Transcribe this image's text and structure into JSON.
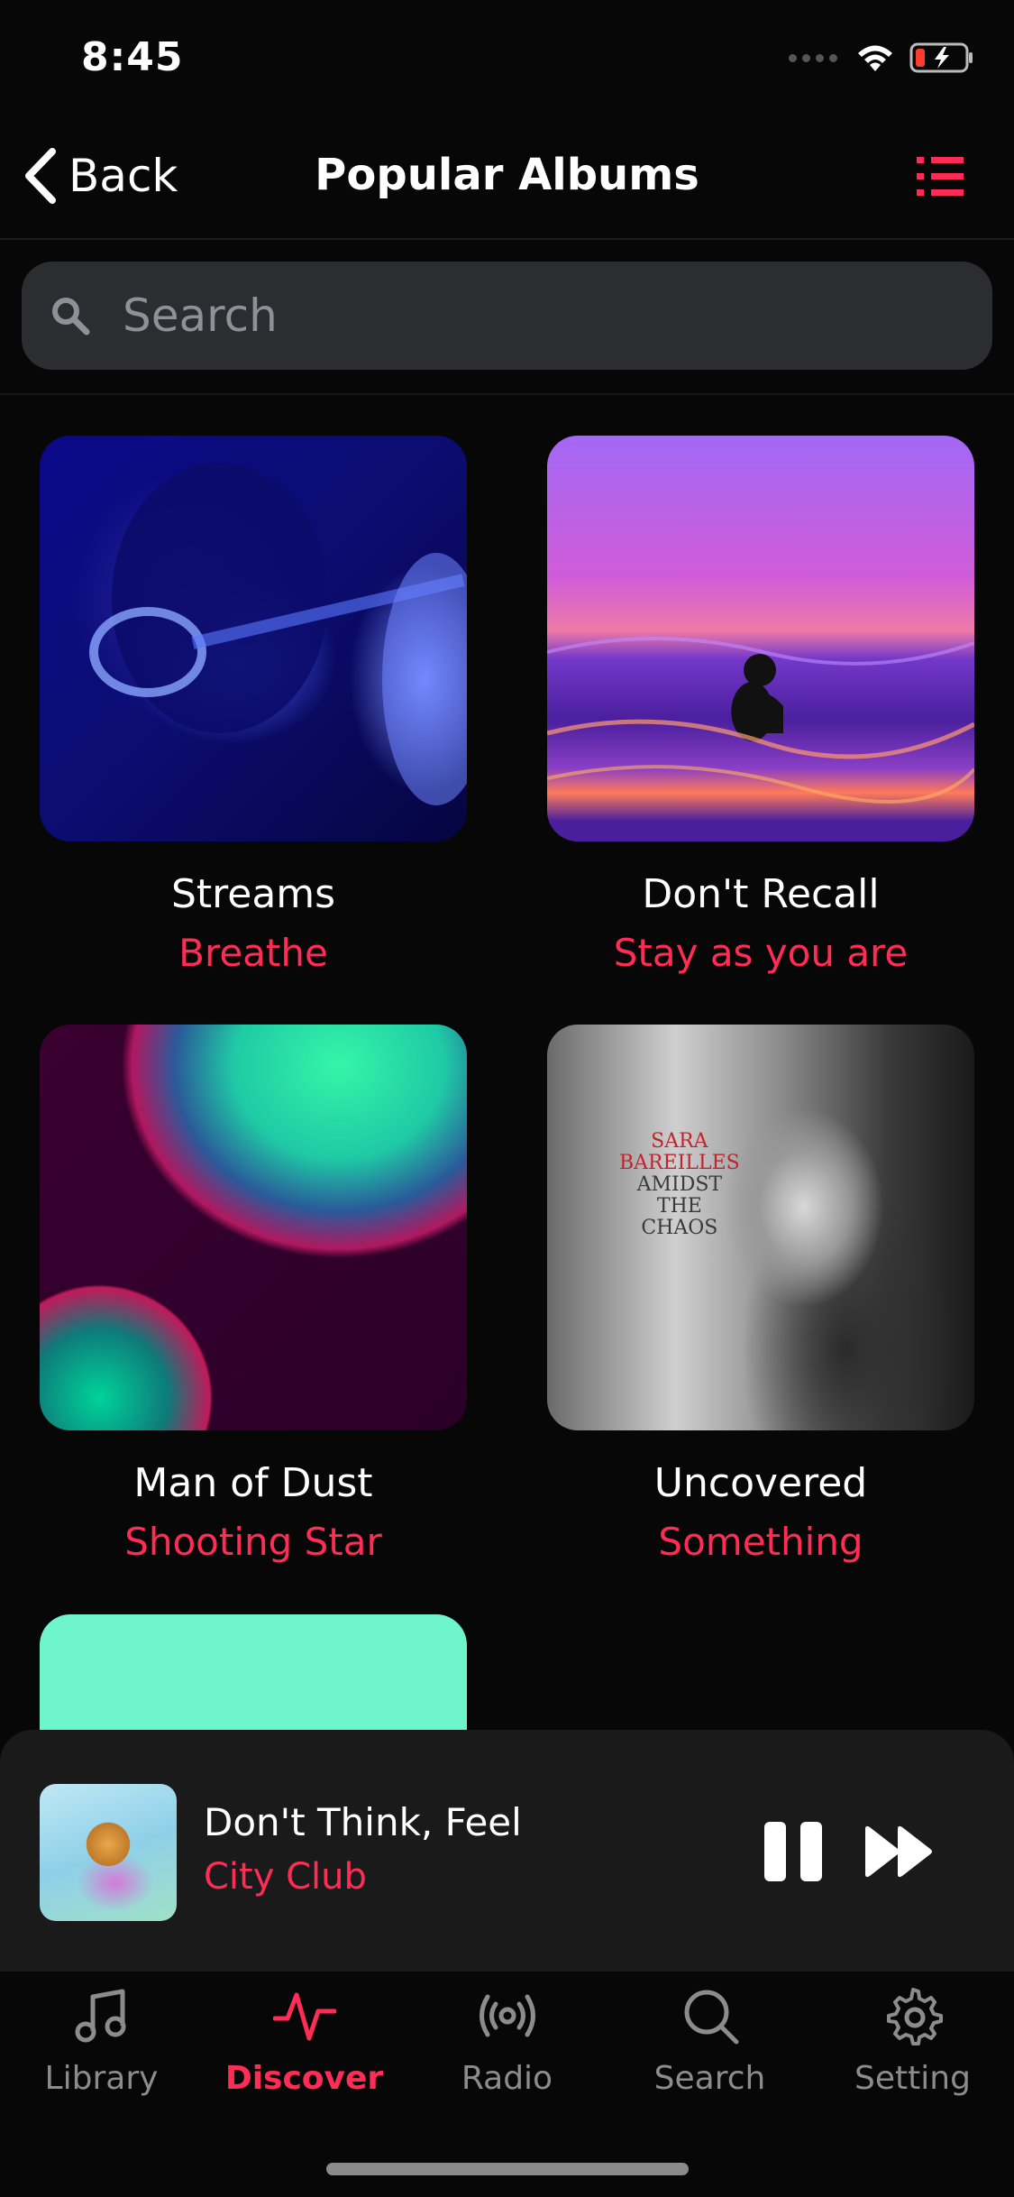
{
  "status_bar": {
    "time": "8:45"
  },
  "nav": {
    "back_label": "Back",
    "title": "Popular Albums"
  },
  "search": {
    "placeholder": "Search"
  },
  "albums": [
    {
      "title": "Streams",
      "subtitle": "Breathe"
    },
    {
      "title": "Don't Recall",
      "subtitle": "Stay as you are"
    },
    {
      "title": "Man of Dust",
      "subtitle": "Shooting Star"
    },
    {
      "title": "Uncovered",
      "subtitle": "Something"
    }
  ],
  "cover_text": {
    "line1": "SARA",
    "line2": "BAREILLES",
    "line3": "AMIDST",
    "line4": "THE",
    "line5": "CHAOS"
  },
  "now_playing": {
    "title": "Don't Think, Feel",
    "artist": "City Club"
  },
  "tabs": [
    {
      "label": "Library",
      "icon": "music-note-icon"
    },
    {
      "label": "Discover",
      "icon": "pulse-icon",
      "active": true
    },
    {
      "label": "Radio",
      "icon": "radio-icon"
    },
    {
      "label": "Search",
      "icon": "search-icon"
    },
    {
      "label": "Setting",
      "icon": "gear-icon"
    }
  ],
  "colors": {
    "accent": "#ff2d55",
    "background": "#070707",
    "search_field": "#2b2d30",
    "player_bg": "#1a1a1a",
    "inactive_tab": "#8c8c8c"
  }
}
